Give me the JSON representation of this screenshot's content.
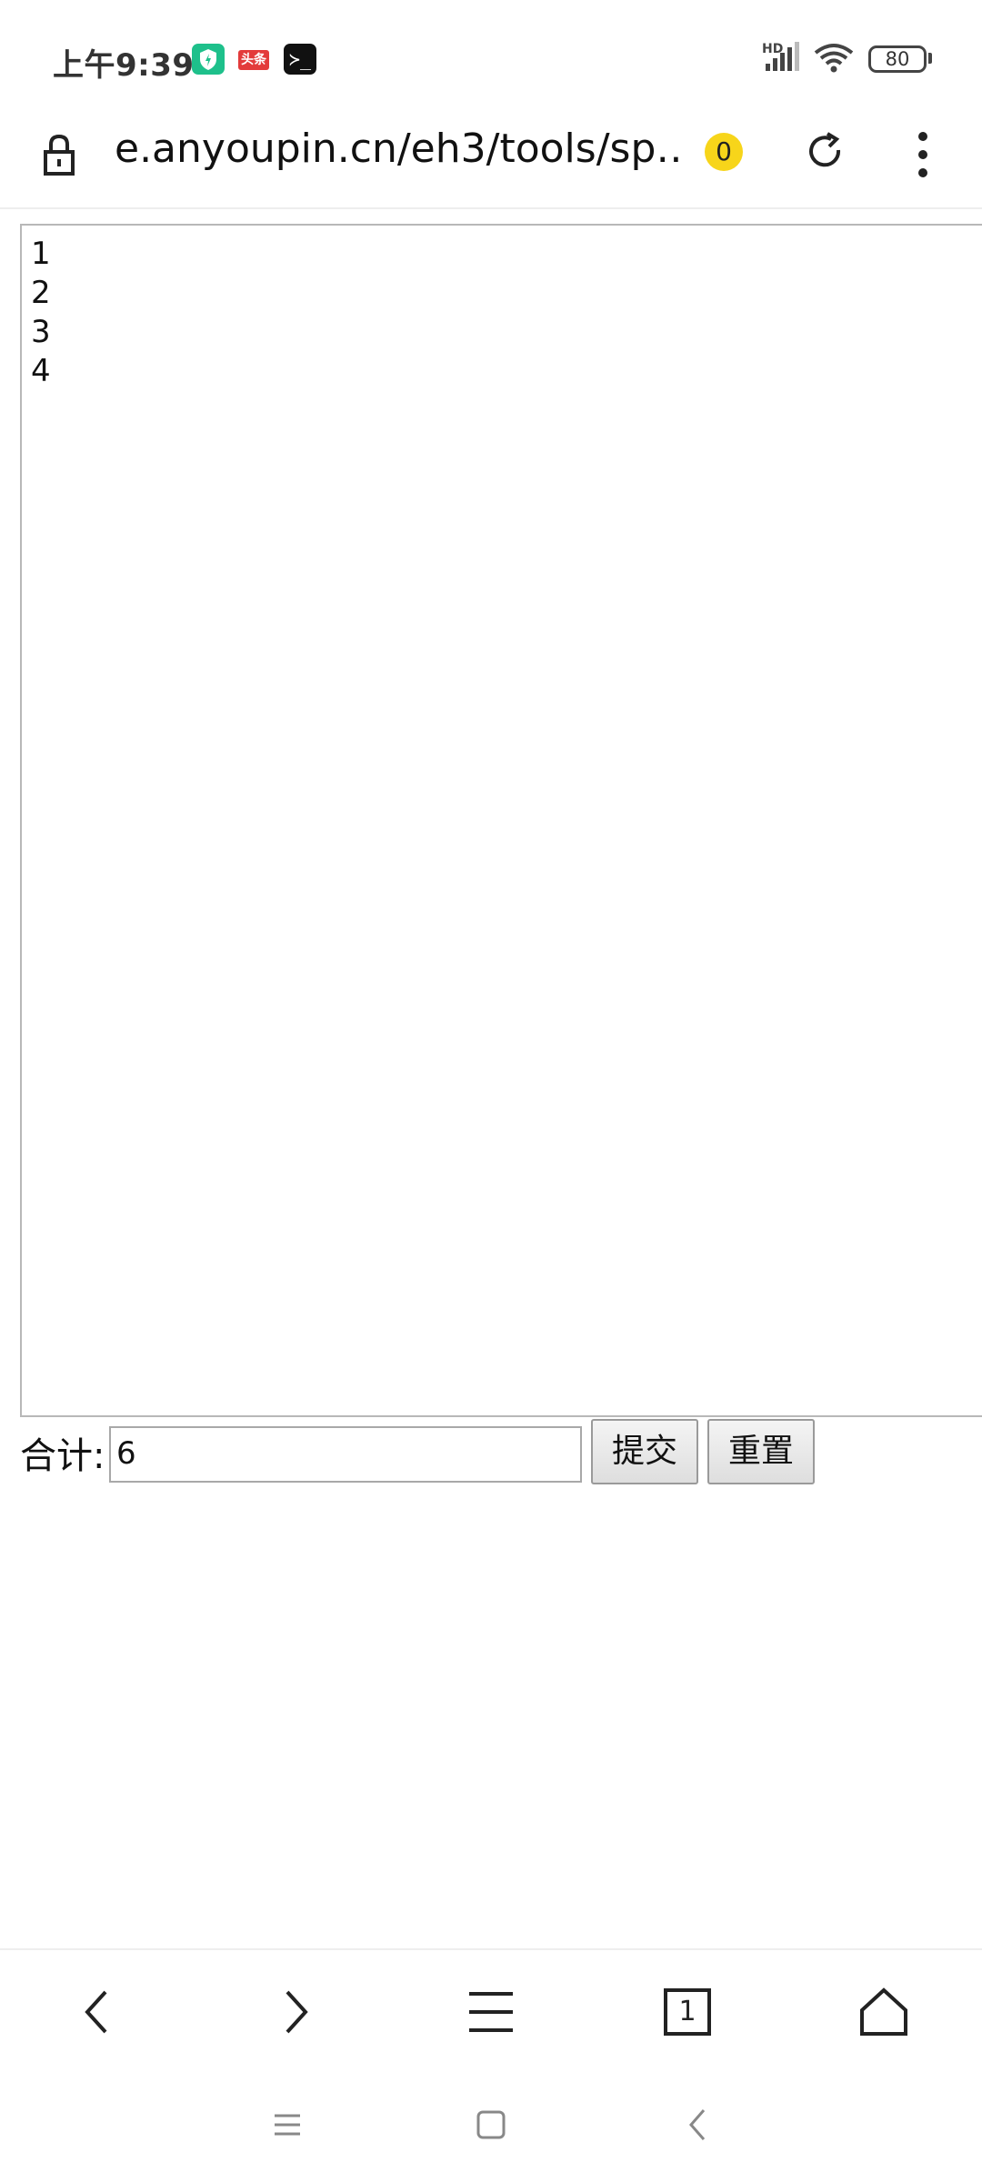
{
  "status_bar": {
    "time": "上午9:39",
    "news_app_label": "头条",
    "terminal_app_label": "≻_",
    "network_label": "HD",
    "battery_level": "80"
  },
  "browser": {
    "url": "e.anyoupin.cn/eh3/tools/sp…",
    "tab_count": "0"
  },
  "page": {
    "textarea_lines": [
      "1",
      "2",
      "3",
      "4"
    ],
    "total_label": "合计:",
    "total_value": "6",
    "submit_label": "提交",
    "reset_label": "重置"
  },
  "toolbar": {
    "tabs_count": "1"
  }
}
